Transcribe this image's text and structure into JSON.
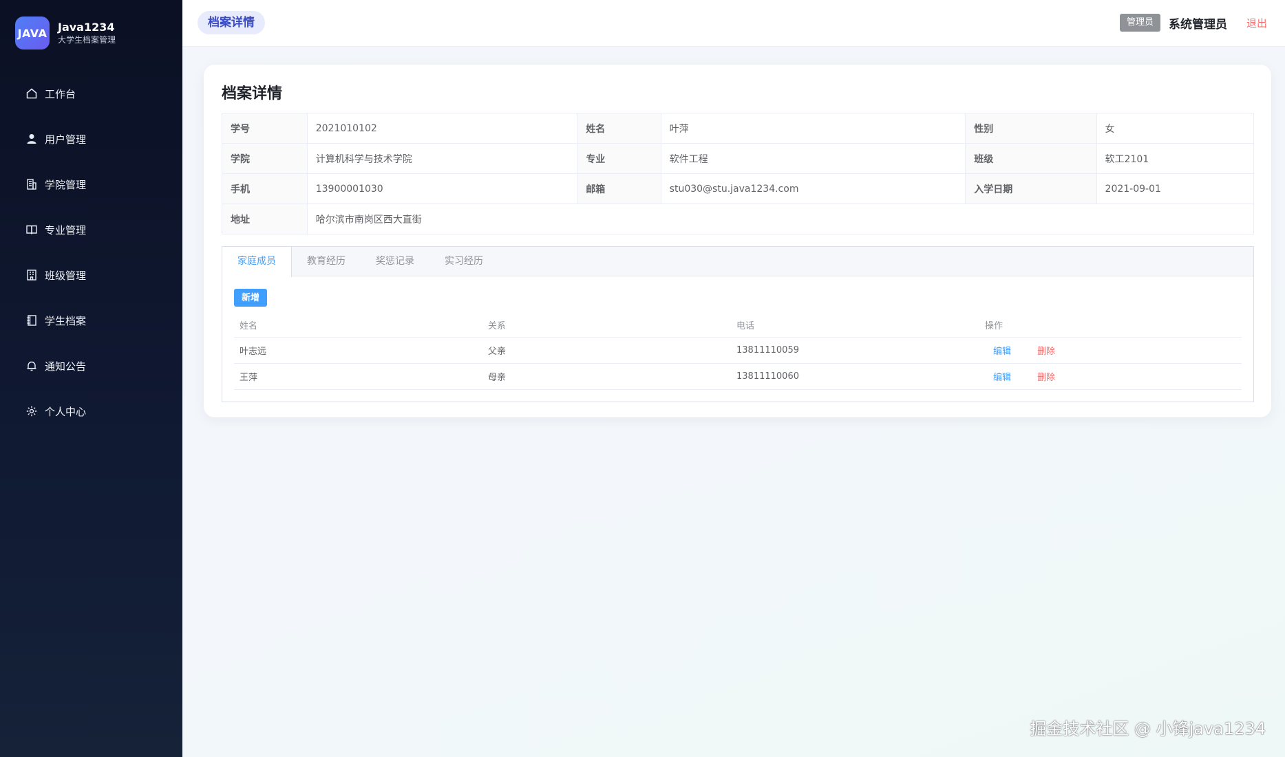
{
  "brand": {
    "logo_text": "JAVA",
    "name": "Java1234",
    "subtitle": "大学生档案管理"
  },
  "sidebar": {
    "items": [
      {
        "label": "工作台",
        "icon": "home-icon"
      },
      {
        "label": "用户管理",
        "icon": "user-icon"
      },
      {
        "label": "学院管理",
        "icon": "building-icon"
      },
      {
        "label": "专业管理",
        "icon": "book-icon"
      },
      {
        "label": "班级管理",
        "icon": "class-icon"
      },
      {
        "label": "学生档案",
        "icon": "notebook-icon"
      },
      {
        "label": "通知公告",
        "icon": "bell-icon"
      },
      {
        "label": "个人中心",
        "icon": "gear-icon"
      }
    ]
  },
  "header": {
    "breadcrumb": "档案详情",
    "role_badge": "管理员",
    "user_name": "系统管理员",
    "logout": "退出"
  },
  "card": {
    "title": "档案详情"
  },
  "profile": {
    "rows": [
      [
        {
          "label": "学号",
          "value": "2021010102"
        },
        {
          "label": "姓名",
          "value": "叶萍"
        },
        {
          "label": "性别",
          "value": "女"
        }
      ],
      [
        {
          "label": "学院",
          "value": "计算机科学与技术学院"
        },
        {
          "label": "专业",
          "value": "软件工程"
        },
        {
          "label": "班级",
          "value": "软工2101"
        }
      ],
      [
        {
          "label": "手机",
          "value": "13900001030"
        },
        {
          "label": "邮箱",
          "value": "stu030@stu.java1234.com"
        },
        {
          "label": "入学日期",
          "value": "2021-09-01"
        }
      ]
    ],
    "address_label": "地址",
    "address_value": "哈尔滨市南岗区西大直街"
  },
  "tabs": {
    "items": [
      "家庭成员",
      "教育经历",
      "奖惩记录",
      "实习经历"
    ],
    "active": "家庭成员"
  },
  "family": {
    "add_label": "新增",
    "columns": [
      "姓名",
      "关系",
      "电话",
      "操作"
    ],
    "rows": [
      {
        "name": "叶志远",
        "relation": "父亲",
        "phone": "13811110059",
        "edit": "编辑",
        "delete": "删除"
      },
      {
        "name": "王萍",
        "relation": "母亲",
        "phone": "13811110060",
        "edit": "编辑",
        "delete": "删除"
      }
    ]
  },
  "watermark": "掘金技术社区 @ 小锋java1234"
}
